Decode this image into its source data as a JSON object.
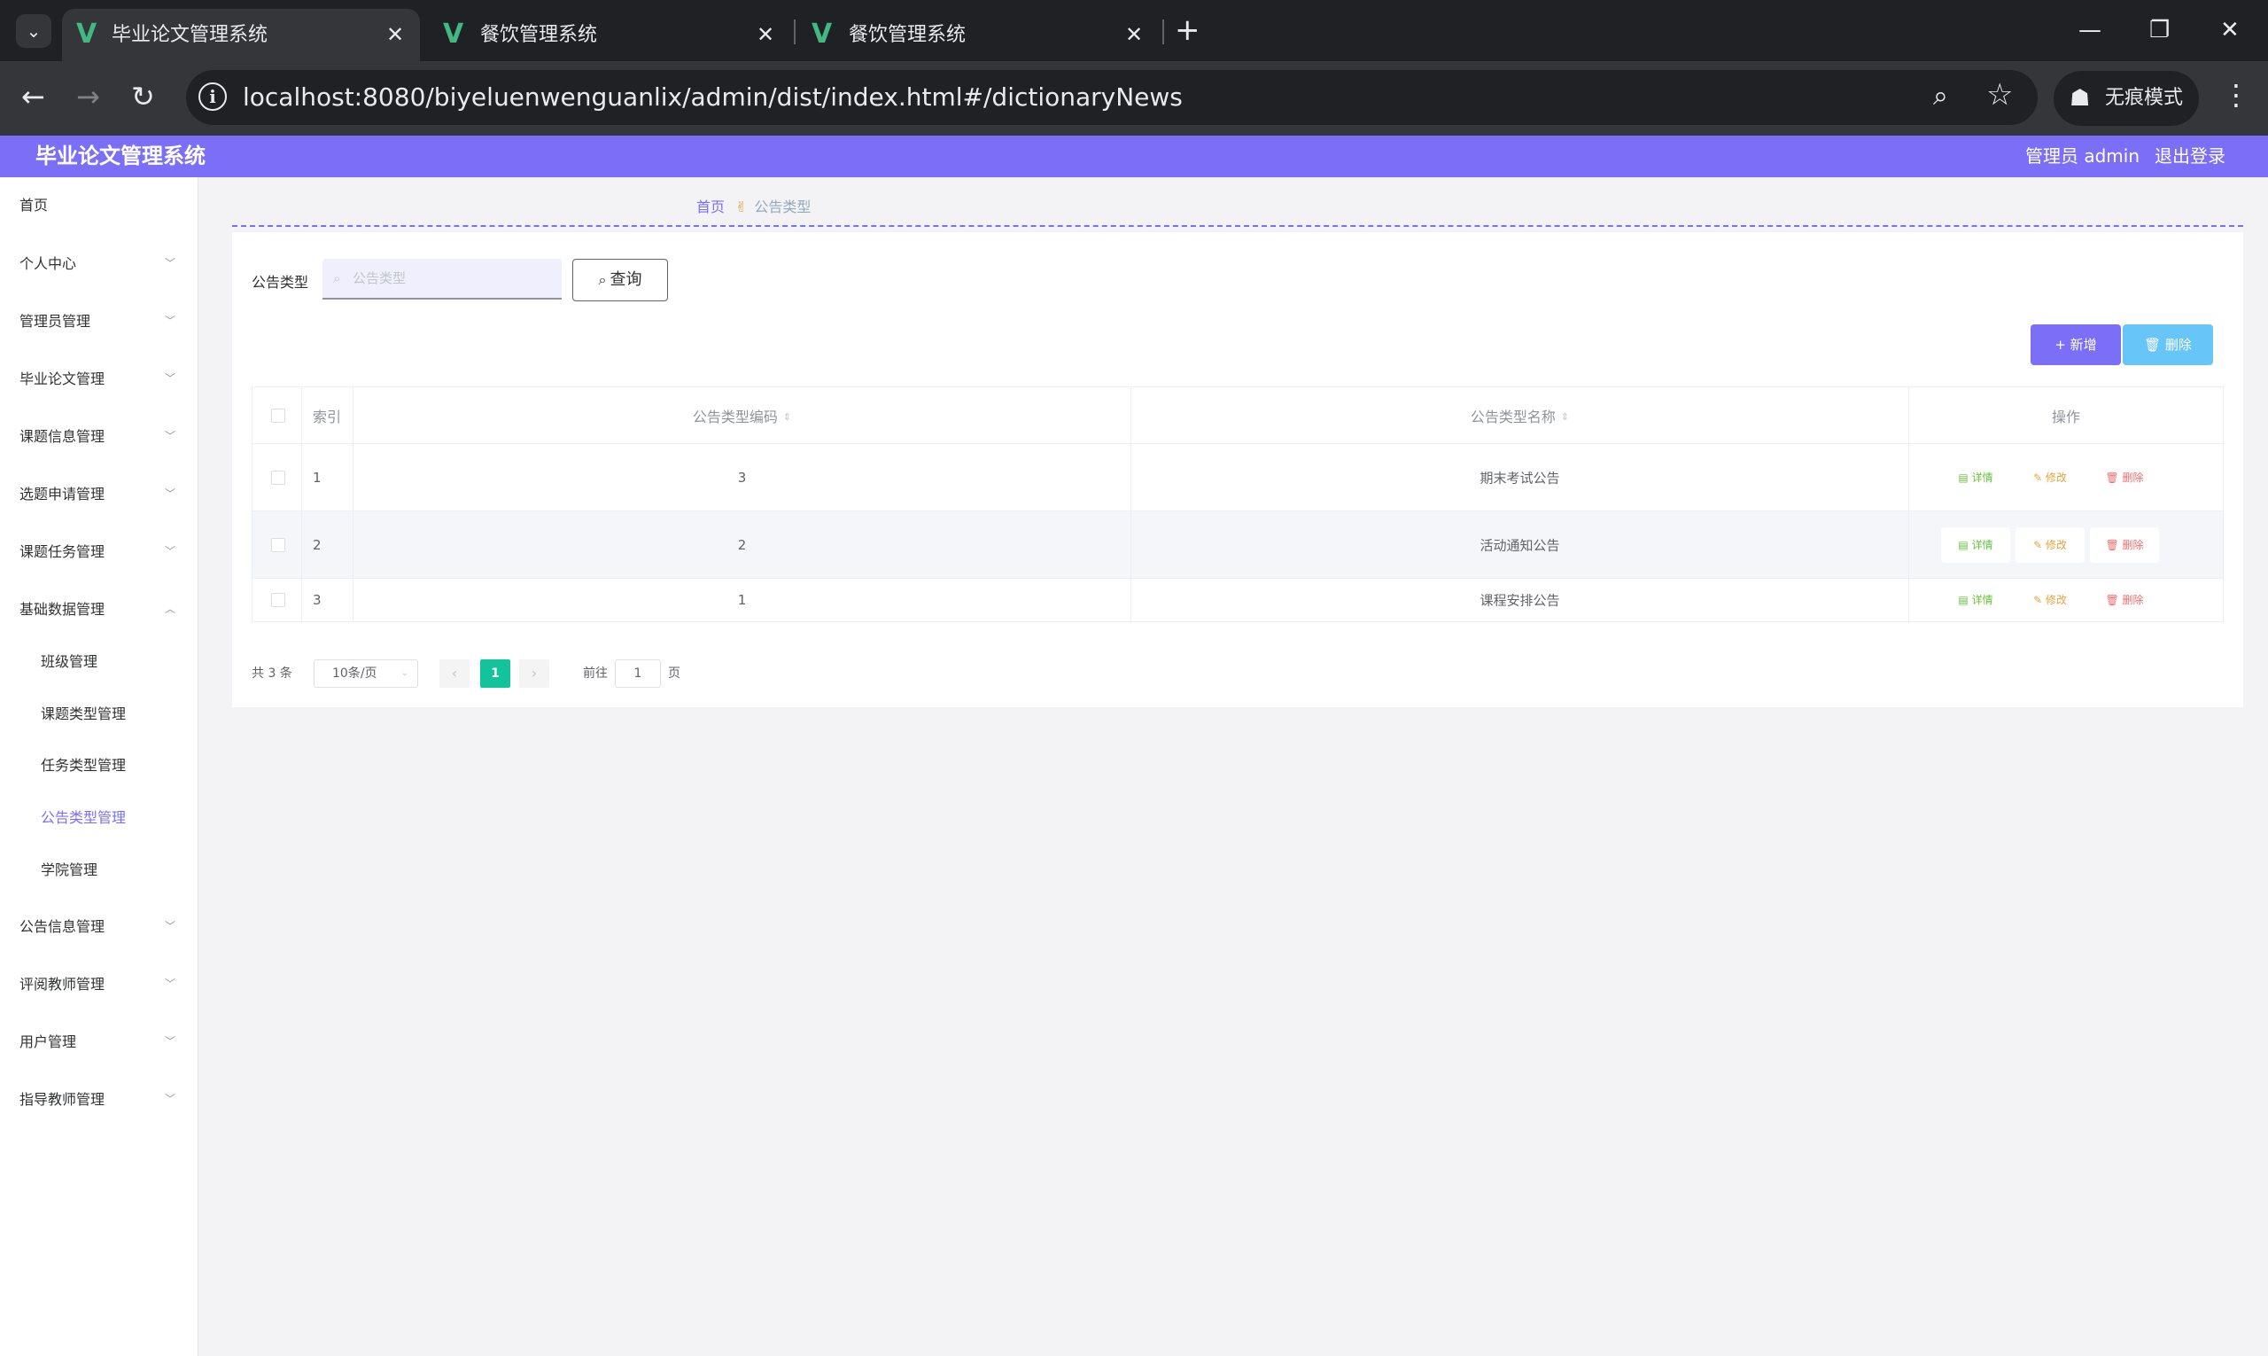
{
  "browser": {
    "tabs": [
      {
        "title": "毕业论文管理系统",
        "close": "✕"
      },
      {
        "title": "餐饮管理系统",
        "close": "✕"
      },
      {
        "title": "餐饮管理系统",
        "close": "✕"
      }
    ],
    "tab_dropdown": "⌄",
    "new_tab": "+",
    "window": {
      "minimize": "—",
      "restore": "❐",
      "close": "✕"
    },
    "nav": {
      "back": "←",
      "forward": "→",
      "reload": "↻"
    },
    "url": "localhost:8080/biyeluenwenguanlix/admin/dist/index.html#/dictionaryNews",
    "incognito_label": "无痕模式",
    "icons": {
      "info": "i",
      "zoom": "⌕",
      "star": "☆",
      "incognito": "☗",
      "menu": "⋮",
      "vue_logo": "V"
    }
  },
  "header": {
    "app_title": "毕业论文管理系统",
    "user_label": "管理员 admin",
    "logout_label": "退出登录"
  },
  "sidebar": {
    "items": [
      {
        "label": "首页"
      },
      {
        "label": "个人中心",
        "chevron": "﹀"
      },
      {
        "label": "管理员管理",
        "chevron": "﹀"
      },
      {
        "label": "毕业论文管理",
        "chevron": "﹀"
      },
      {
        "label": "课题信息管理",
        "chevron": "﹀"
      },
      {
        "label": "选题申请管理",
        "chevron": "﹀"
      },
      {
        "label": "课题任务管理",
        "chevron": "﹀"
      },
      {
        "label": "基础数据管理",
        "chevron": "︿"
      },
      {
        "label": "班级管理"
      },
      {
        "label": "课题类型管理"
      },
      {
        "label": "任务类型管理"
      },
      {
        "label": "公告类型管理"
      },
      {
        "label": "学院管理"
      },
      {
        "label": "公告信息管理",
        "chevron": "﹀"
      },
      {
        "label": "评阅教师管理",
        "chevron": "﹀"
      },
      {
        "label": "用户管理",
        "chevron": "﹀"
      },
      {
        "label": "指导教师管理",
        "chevron": "﹀"
      }
    ],
    "active_item": "公告类型管理"
  },
  "breadcrumb": {
    "home": "首页",
    "separator": "✌",
    "current": "公告类型"
  },
  "search": {
    "label": "公告类型",
    "placeholder": "公告类型",
    "value": "",
    "icon": "⌕",
    "button_label": "查询",
    "button_icon": "⌕"
  },
  "actions": {
    "add_label": "+ 新增",
    "delete_label": "🗑 删除"
  },
  "table": {
    "headers": {
      "index": "索引",
      "code": "公告类型编码",
      "name": "公告类型名称",
      "ops": "操作",
      "sort": "⇕"
    },
    "rows": [
      {
        "index": "1",
        "code": "3",
        "name": "期末考试公告"
      },
      {
        "index": "2",
        "code": "2",
        "name": "活动通知公告"
      },
      {
        "index": "3",
        "code": "1",
        "name": "课程安排公告"
      }
    ],
    "op_labels": {
      "detail": "▤ 详情",
      "edit": "✎ 修改",
      "remove": "🗑 删除"
    }
  },
  "pagination": {
    "total": "共 3 条",
    "page_size": "10条/页",
    "page_size_caret": "⌄",
    "prev": "‹",
    "next": "›",
    "current_page": "1",
    "goto_label": "前往",
    "goto_value": "1",
    "page_suffix": "页"
  },
  "colors": {
    "accent": "#7b6ff7",
    "pager_active": "#12c39b",
    "delete_button": "#67c5f8"
  }
}
